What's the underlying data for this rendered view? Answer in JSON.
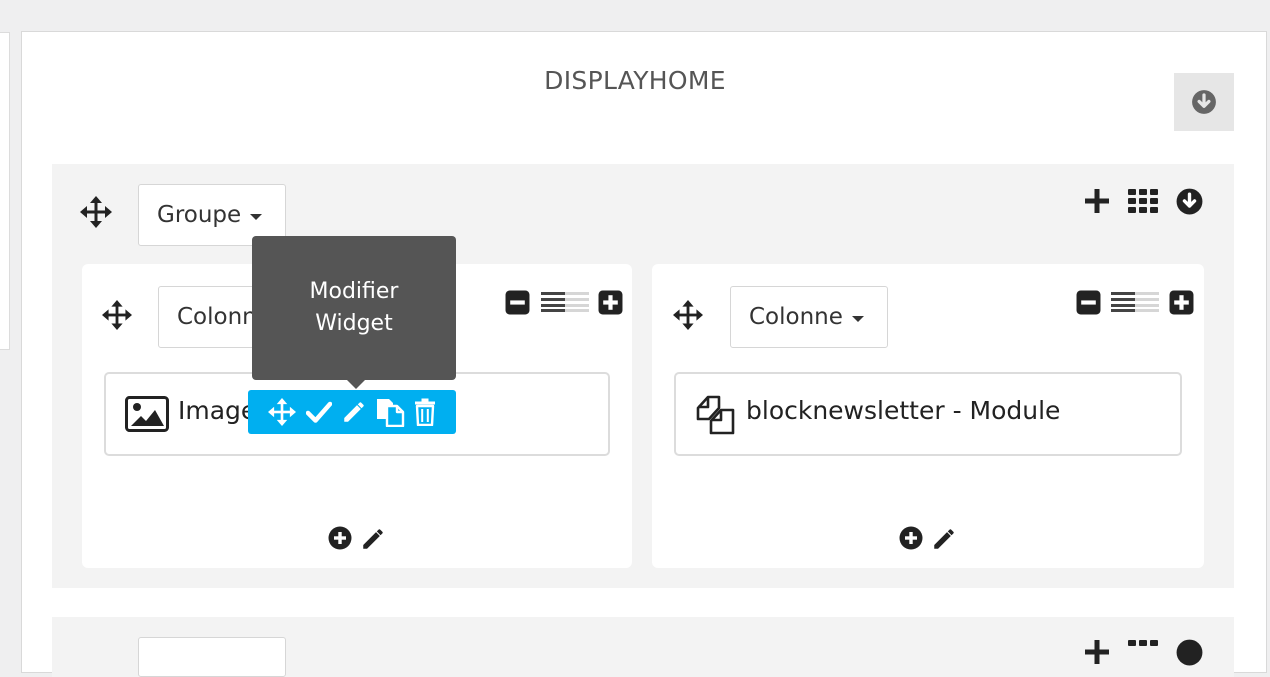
{
  "hook": {
    "title": "DISPLAYHOME",
    "collapse_icon": "arrow-circle-down-icon"
  },
  "group": {
    "type_label": "Groupe",
    "actions": [
      "plus-icon",
      "grid-icon",
      "arrow-circle-down-icon"
    ]
  },
  "columns": [
    {
      "type_label": "Colonne",
      "width_controls": [
        "minus-square-icon",
        "column-width-bars-icon",
        "plus-square-icon"
      ],
      "widget": {
        "label": "Image",
        "icon": "image-icon"
      },
      "footer_actions": [
        "plus-circle-icon",
        "pencil-icon"
      ]
    },
    {
      "type_label": "Colonne",
      "width_controls": [
        "minus-square-icon",
        "column-width-bars-icon",
        "plus-square-icon"
      ],
      "widget": {
        "label": "blocknewsletter - Module",
        "icon": "module-copy-icon"
      },
      "footer_actions": [
        "plus-circle-icon",
        "pencil-icon"
      ]
    }
  ],
  "tooltip": {
    "line1": "Modifier",
    "line2": "Widget"
  },
  "widget_toolbar": {
    "actions": [
      "move-icon",
      "check-icon",
      "pencil-icon",
      "copy-icon",
      "trash-icon"
    ],
    "color": "#00aff0"
  }
}
